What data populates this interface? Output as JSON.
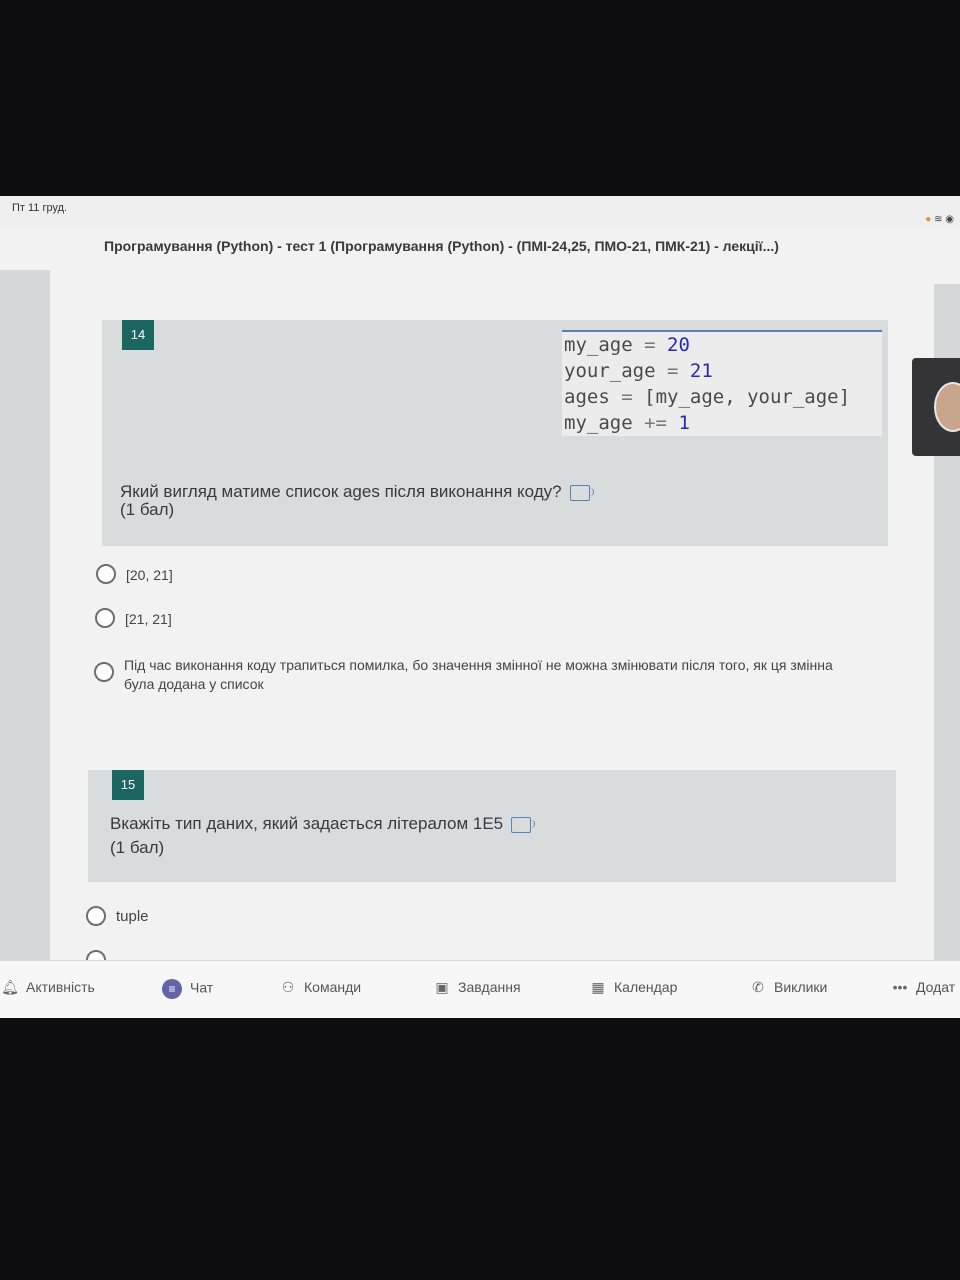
{
  "status_bar": {
    "time": "Пт 11 груд."
  },
  "form": {
    "title": "Програмування (Python) - тест 1 (Програмування (Python) - (ПМІ-24,25, ПМО-21, ПМК-21) - лекції...)"
  },
  "questions": [
    {
      "number": "14",
      "code": [
        {
          "name": "my_age",
          "op": "=",
          "value": "20"
        },
        {
          "name": "your_age",
          "op": "=",
          "value": "21"
        },
        {
          "name": "ages",
          "op": "=",
          "value": "[my_age, your_age]"
        },
        {
          "name": "my_age",
          "op": "+=",
          "value": "1"
        }
      ],
      "text": "Який вигляд матиме список ages після виконання коду?",
      "points": "(1 бал)",
      "options": [
        {
          "label": "[20, 21]"
        },
        {
          "label": "[21, 21]"
        },
        {
          "label": "Під час виконання коду трапиться помилка, бо значення змінної не можна змінювати після того, як ця змінна була додана у список"
        }
      ]
    },
    {
      "number": "15",
      "text": "Вкажіть тип даних, який задається літералом 1E5",
      "points": "(1 бал)",
      "options": [
        {
          "label": "tuple"
        }
      ]
    }
  ],
  "bottom_nav": [
    {
      "label": "Активність",
      "icon": "bell-icon"
    },
    {
      "label": "Чат",
      "icon": "chat-icon"
    },
    {
      "label": "Команди",
      "icon": "teams-icon"
    },
    {
      "label": "Завдання",
      "icon": "backpack-icon"
    },
    {
      "label": "Календар",
      "icon": "calendar-icon"
    },
    {
      "label": "Виклики",
      "icon": "phone-icon"
    },
    {
      "label": "Додат",
      "icon": "more-icon"
    }
  ]
}
